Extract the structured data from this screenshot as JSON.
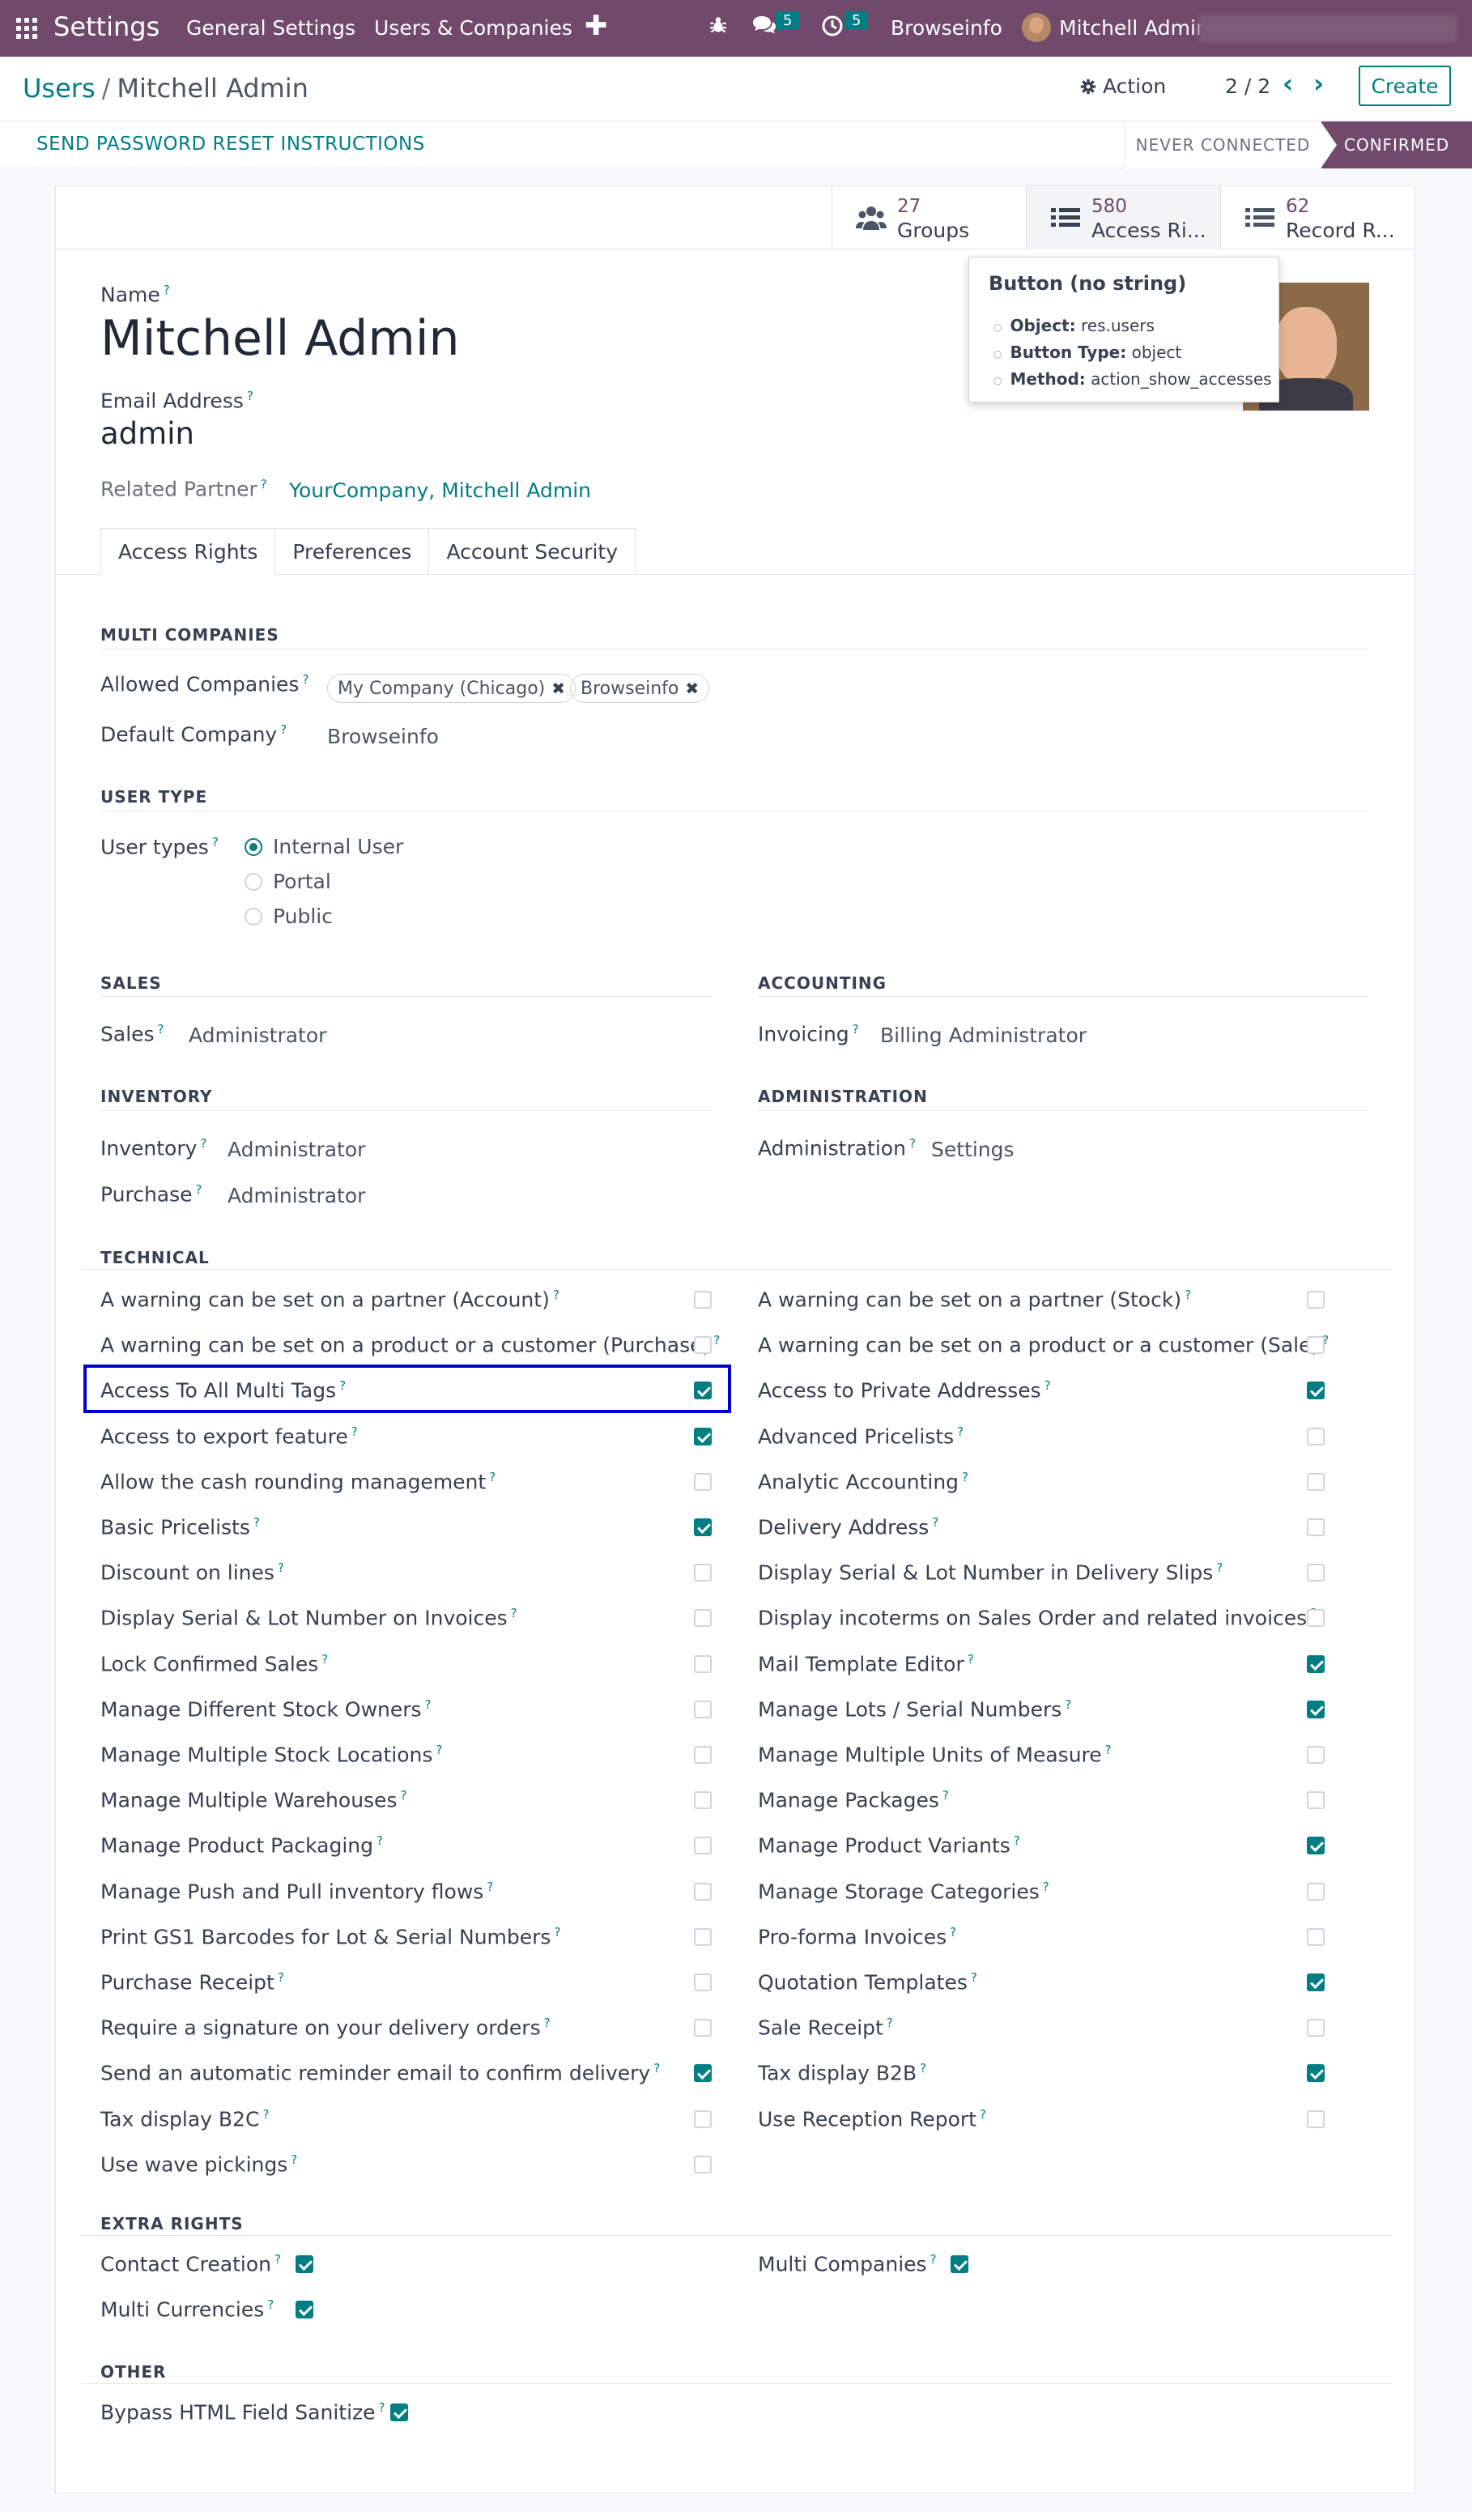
{
  "navbar": {
    "app_title": "Settings",
    "menu": [
      "General Settings",
      "Users & Companies"
    ],
    "plus": "✚",
    "chat_badge": "5",
    "activity_badge": "5",
    "company": "Browseinfo",
    "user": "Mitchell Admin"
  },
  "control": {
    "breadcrumb_parent": "Users",
    "breadcrumb_sep": "/",
    "breadcrumb_current": "Mitchell Admin",
    "action_label": "Action",
    "pager": "2 / 2",
    "create_label": "Create"
  },
  "statusbar": {
    "reset_link": "SEND PASSWORD RESET INSTRUCTIONS",
    "stage_never": "NEVER CONNECTED",
    "stage_confirmed": "CONFIRMED"
  },
  "smart_buttons": [
    {
      "count": "27",
      "label": "Groups"
    },
    {
      "count": "580",
      "label": "Access Ri..."
    },
    {
      "count": "62",
      "label": "Record R..."
    }
  ],
  "tooltip": {
    "title": "Button (no string)",
    "object_label": "Object:",
    "object_value": "res.users",
    "type_label": "Button Type:",
    "type_value": "object",
    "method_label": "Method:",
    "method_value": "action_show_accesses"
  },
  "form": {
    "name_label": "Name",
    "name_value": "Mitchell Admin",
    "email_label": "Email Address",
    "email_value": "admin",
    "partner_label": "Related Partner",
    "partner_value": "YourCompany, Mitchell Admin",
    "help_mark": "?"
  },
  "tabs": [
    "Access Rights",
    "Preferences",
    "Account Security"
  ],
  "multi_companies": {
    "title": "MULTI COMPANIES",
    "allowed_label": "Allowed Companies",
    "allowed_tags": [
      "My Company (Chicago)",
      "Browseinfo"
    ],
    "default_label": "Default Company",
    "default_value": "Browseinfo"
  },
  "user_type": {
    "title": "USER TYPE",
    "label": "User types",
    "options": [
      "Internal User",
      "Portal",
      "Public"
    ],
    "selected": "Internal User"
  },
  "sales": {
    "title": "SALES",
    "label": "Sales",
    "value": "Administrator"
  },
  "accounting": {
    "title": "ACCOUNTING",
    "label": "Invoicing",
    "value": "Billing Administrator"
  },
  "inventory": {
    "title": "INVENTORY",
    "inv_label": "Inventory",
    "inv_value": "Administrator",
    "pur_label": "Purchase",
    "pur_value": "Administrator"
  },
  "administration": {
    "title": "ADMINISTRATION",
    "label": "Administration",
    "value": "Settings"
  },
  "technical": {
    "title": "TECHNICAL",
    "left": [
      {
        "label": "A warning can be set on a partner (Account)",
        "checked": false
      },
      {
        "label": "A warning can be set on a product or a customer (Purchase)",
        "checked": false
      },
      {
        "label": "Access To All Multi Tags",
        "checked": true
      },
      {
        "label": "Access to export feature",
        "checked": true
      },
      {
        "label": "Allow the cash rounding management",
        "checked": false
      },
      {
        "label": "Basic Pricelists",
        "checked": true
      },
      {
        "label": "Discount on lines",
        "checked": false
      },
      {
        "label": "Display Serial & Lot Number on Invoices",
        "checked": false
      },
      {
        "label": "Lock Confirmed Sales",
        "checked": false
      },
      {
        "label": "Manage Different Stock Owners",
        "checked": false
      },
      {
        "label": "Manage Multiple Stock Locations",
        "checked": false
      },
      {
        "label": "Manage Multiple Warehouses",
        "checked": false
      },
      {
        "label": "Manage Product Packaging",
        "checked": false
      },
      {
        "label": "Manage Push and Pull inventory flows",
        "checked": false
      },
      {
        "label": "Print GS1 Barcodes for Lot & Serial Numbers",
        "checked": false
      },
      {
        "label": "Purchase Receipt",
        "checked": false
      },
      {
        "label": "Require a signature on your delivery orders",
        "checked": false
      },
      {
        "label": "Send an automatic reminder email to confirm delivery",
        "checked": true
      },
      {
        "label": "Tax display B2C",
        "checked": false
      },
      {
        "label": "Use wave pickings",
        "checked": false
      }
    ],
    "right": [
      {
        "label": "A warning can be set on a partner (Stock)",
        "checked": false
      },
      {
        "label": "A warning can be set on a product or a customer (Sale)",
        "checked": false
      },
      {
        "label": "Access to Private Addresses",
        "checked": true
      },
      {
        "label": "Advanced Pricelists",
        "checked": false
      },
      {
        "label": "Analytic Accounting",
        "checked": false
      },
      {
        "label": "Delivery Address",
        "checked": false
      },
      {
        "label": "Display Serial & Lot Number in Delivery Slips",
        "checked": false
      },
      {
        "label": "Display incoterms on Sales Order and related invoices",
        "checked": false
      },
      {
        "label": "Mail Template Editor",
        "checked": true
      },
      {
        "label": "Manage Lots / Serial Numbers",
        "checked": true
      },
      {
        "label": "Manage Multiple Units of Measure",
        "checked": false
      },
      {
        "label": "Manage Packages",
        "checked": false
      },
      {
        "label": "Manage Product Variants",
        "checked": true
      },
      {
        "label": "Manage Storage Categories",
        "checked": false
      },
      {
        "label": "Pro-forma Invoices",
        "checked": false
      },
      {
        "label": "Quotation Templates",
        "checked": true
      },
      {
        "label": "Sale Receipt",
        "checked": false
      },
      {
        "label": "Tax display B2B",
        "checked": true
      },
      {
        "label": "Use Reception Report",
        "checked": false
      }
    ]
  },
  "extra_rights": {
    "title": "EXTRA RIGHTS",
    "items": [
      {
        "label": "Contact Creation",
        "checked": true
      },
      {
        "label": "Multi Companies",
        "checked": true
      },
      {
        "label": "Multi Currencies",
        "checked": true
      }
    ]
  },
  "other": {
    "title": "OTHER",
    "items": [
      {
        "label": "Bypass HTML Field Sanitize",
        "checked": true
      }
    ]
  },
  "colors": {
    "brand": "#71496a",
    "accent": "#017e84",
    "highlight": "#0000cc"
  }
}
